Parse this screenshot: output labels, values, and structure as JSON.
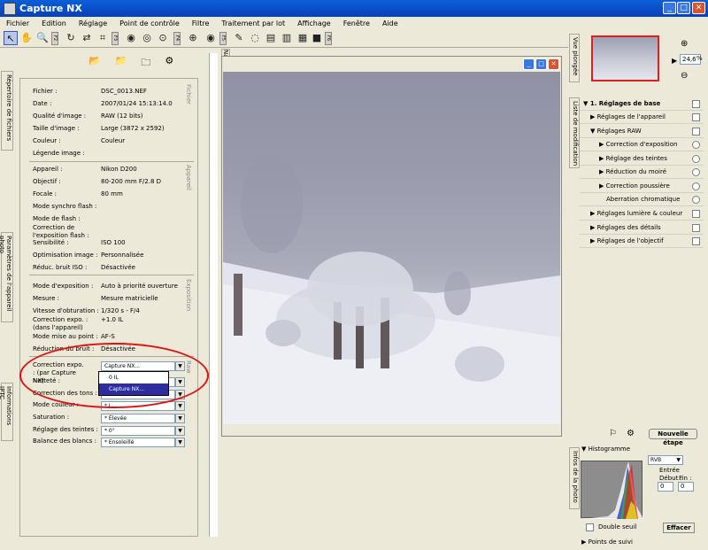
{
  "window": {
    "title": "Capture NX"
  },
  "menu": [
    "Fichier",
    "Edition",
    "Réglage",
    "Point de contrôle",
    "Filtre",
    "Traitement par lot",
    "Affichage",
    "Fenêtre",
    "Aide"
  ],
  "toolbar": {
    "fkeys": [
      "F2",
      "F3",
      "F4",
      "F5",
      "F6"
    ]
  },
  "left_tabs": {
    "file_browser": "Répertoire de fichiers",
    "camera_settings": "Paramètres de l'appareil photo",
    "iptc": "Informations IPTC"
  },
  "info": {
    "section_file": "Fichier",
    "file": [
      {
        "label": "Fichier :",
        "value": "DSC_0013.NEF"
      },
      {
        "label": "Date :",
        "value": "2007/01/24 15:13:14.0"
      },
      {
        "label": "Qualité d'image :",
        "value": "RAW (12 bits)"
      },
      {
        "label": "Taille d'image :",
        "value": "Large (3872 x 2592)"
      },
      {
        "label": "Couleur :",
        "value": "Couleur"
      },
      {
        "label": "Légende image :",
        "value": ""
      }
    ],
    "section_camera": "Appareil",
    "camera": [
      {
        "label": "Appareil :",
        "value": "Nikon D200"
      },
      {
        "label": "Objectif :",
        "value": "80-200 mm F/2.8 D"
      },
      {
        "label": "Focale :",
        "value": "80 mm"
      },
      {
        "label": "Mode synchro flash :",
        "value": ""
      },
      {
        "label": "Mode de flash :",
        "value": ""
      },
      {
        "label": "Correction de l'exposition flash :",
        "value": ""
      },
      {
        "label": "Sensibilité :",
        "value": "ISO 100"
      },
      {
        "label": "Optimisation image :",
        "value": "Personnalisée"
      },
      {
        "label": "Réduc. bruit ISO :",
        "value": "Désactivée"
      }
    ],
    "section_exposure": "Exposition",
    "exposure": [
      {
        "label": "Mode d'exposition :",
        "value": "Auto à priorité ouverture"
      },
      {
        "label": "Mesure :",
        "value": "Mesure matricielle"
      },
      {
        "label": "Vitesse d'obturation :",
        "value": "1/320  s - F/4"
      },
      {
        "label": "Correction expo. : (dans l'appareil)",
        "value": "+1.0 IL"
      },
      {
        "label": "Mode mise au point :",
        "value": "AF-S"
      },
      {
        "label": "Réduction du bruit :",
        "value": "Désactivée"
      }
    ],
    "section_raw": "Raw",
    "raw": [
      {
        "label": "Correction expo. : (par Capture NX)",
        "value": "Capture NX..."
      },
      {
        "label": "Netteté :",
        "value": ""
      },
      {
        "label": "Correction des tons :",
        "value": ""
      },
      {
        "label": "Mode couleur :",
        "value": "* I"
      },
      {
        "label": "Saturation :",
        "value": "* Élevée"
      },
      {
        "label": "Réglage des teintes :",
        "value": "* 0°"
      },
      {
        "label": "Balance des blancs :",
        "value": "* Ensoleillé"
      }
    ],
    "dropdown_options": [
      "0 IL",
      "Capture NX..."
    ]
  },
  "navigator_tab": "Navigateur",
  "right": {
    "bird_view_tab": "Vue plongée",
    "zoom": "24,6",
    "zoom_unit": "%",
    "edit_list_tab": "Liste de modification",
    "edit_items": [
      {
        "label": "1. Réglages de base",
        "indent": 0,
        "type": "check"
      },
      {
        "label": "Réglages de l'appareil",
        "indent": 1,
        "type": "check"
      },
      {
        "label": "Réglages RAW",
        "indent": 1,
        "type": "check"
      },
      {
        "label": "Correction d'exposition",
        "indent": 2,
        "type": "radio"
      },
      {
        "label": "Réglage des teintes",
        "indent": 2,
        "type": "radio"
      },
      {
        "label": "Réduction du moiré",
        "indent": 2,
        "type": "radio"
      },
      {
        "label": "Correction poussière",
        "indent": 2,
        "type": "radio"
      },
      {
        "label": "Aberration chromatique",
        "indent": 2,
        "type": "radio"
      },
      {
        "label": "Réglages lumière & couleur",
        "indent": 1,
        "type": "check"
      },
      {
        "label": "Réglages des détails",
        "indent": 1,
        "type": "check"
      },
      {
        "label": "Réglages de l'objectif",
        "indent": 1,
        "type": "check"
      }
    ],
    "new_step": "Nouvelle étape",
    "photo_info_tab": "Infos de la photo",
    "histogram": "Histogramme",
    "histo_channel": "RVB",
    "entree": "Entrée",
    "debut": "Début :",
    "fin": "Fin :",
    "debut_val": "0",
    "fin_val": "0",
    "double_seuil": "Double seuil",
    "effacer": "Effacer",
    "tracking_points": "Points de suivi"
  }
}
